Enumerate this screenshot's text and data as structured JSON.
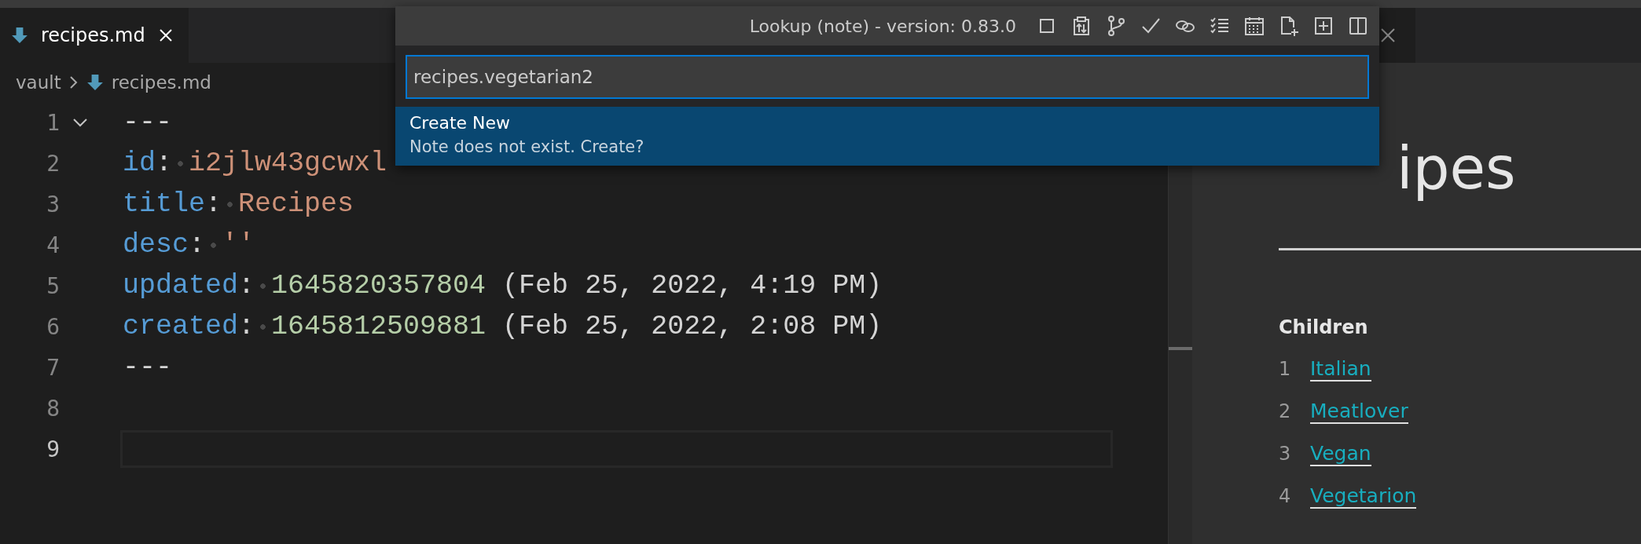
{
  "editor": {
    "tab": {
      "label": "recipes.md",
      "selected": true
    },
    "breadcrumb": [
      "vault",
      "recipes.md"
    ],
    "lines": [
      {
        "number": "1",
        "kind": "rule",
        "text": "---",
        "foldable": true,
        "current": false
      },
      {
        "number": "2",
        "kind": "field",
        "key": "id",
        "separator": ":",
        "value": {
          "kind": "string",
          "text": "i2jlw43gcwxl"
        },
        "current": false
      },
      {
        "number": "3",
        "kind": "field",
        "key": "title",
        "separator": ":",
        "value": {
          "kind": "string",
          "text": "Recipes"
        },
        "current": false
      },
      {
        "number": "4",
        "kind": "field",
        "key": "desc",
        "separator": ":",
        "value": {
          "kind": "string",
          "text": "''"
        },
        "current": false
      },
      {
        "number": "5",
        "kind": "field",
        "key": "updated",
        "separator": ":",
        "value": {
          "kind": "number",
          "text": "1645820357804"
        },
        "note": "(Feb 25, 2022, 4:19 PM)",
        "current": false
      },
      {
        "number": "6",
        "kind": "field",
        "key": "created",
        "separator": ":",
        "value": {
          "kind": "number",
          "text": "1645812509881"
        },
        "note": "(Feb 25, 2022, 2:08 PM)",
        "current": false
      },
      {
        "number": "7",
        "kind": "rule",
        "text": "---",
        "current": false
      },
      {
        "number": "8",
        "kind": "blank",
        "current": false
      },
      {
        "number": "9",
        "kind": "blank",
        "current": true
      }
    ]
  },
  "lookup": {
    "title": "Lookup (note) - version: 0.83.0",
    "toolbar": [
      {
        "kind": "square"
      },
      {
        "kind": "clipboard"
      },
      {
        "kind": "branch"
      },
      {
        "kind": "check"
      },
      {
        "kind": "link"
      },
      {
        "kind": "checklist"
      },
      {
        "kind": "calendar"
      },
      {
        "kind": "new-file"
      },
      {
        "kind": "plus-box"
      },
      {
        "kind": "split"
      }
    ],
    "input": {
      "value": "recipes.vegetarian2"
    },
    "results": [
      {
        "title": "Create New",
        "detail": "Note does not exist. Create?",
        "selected": true
      }
    ]
  },
  "preview": {
    "heading": "ipes",
    "section": "Children",
    "children": [
      {
        "number": "1",
        "label": "Italian"
      },
      {
        "number": "2",
        "label": "Meatlover"
      },
      {
        "number": "3",
        "label": "Vegan"
      },
      {
        "number": "4",
        "label": "Vegetarion"
      }
    ]
  }
}
